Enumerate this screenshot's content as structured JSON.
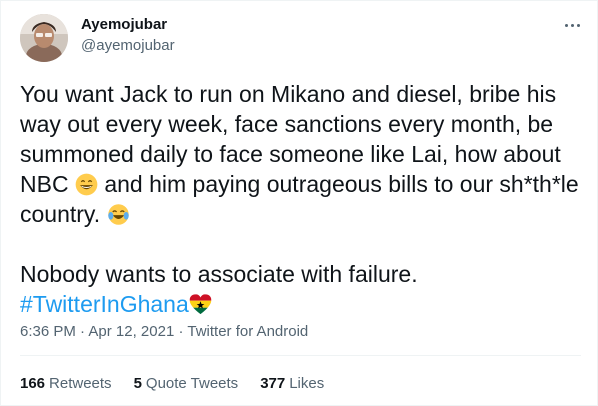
{
  "author": {
    "display_name": "Ayemojubar",
    "handle": "@ayemojubar"
  },
  "icons": {
    "more": "more-horizontal-icon",
    "emoji_grin": "grinning-face-emoji",
    "emoji_tears": "face-with-tears-of-joy-emoji",
    "emoji_heart": "ghana-flag-heart-emoji"
  },
  "tweet": {
    "line1": "You want Jack to run on Mikano and diesel, bribe his way out every week, face sanctions every month, be summoned daily to face someone like Lai, how about NBC",
    "line2": "and him paying outrageous bills to our sh*th*le country.",
    "line3": "Nobody wants to associate with failure.",
    "hashtag": "#TwitterInGhana"
  },
  "meta": {
    "time": "6:36 PM",
    "separator": "·",
    "date": "Apr 12, 2021",
    "source": "Twitter for Android"
  },
  "stats": {
    "retweets_count": "166",
    "retweets_label": "Retweets",
    "quotes_count": "5",
    "quotes_label": "Quote Tweets",
    "likes_count": "377",
    "likes_label": "Likes"
  },
  "colors": {
    "text": "#0f1419",
    "secondary": "#536471",
    "link": "#1d9bf0",
    "divider": "#eff3f4"
  }
}
